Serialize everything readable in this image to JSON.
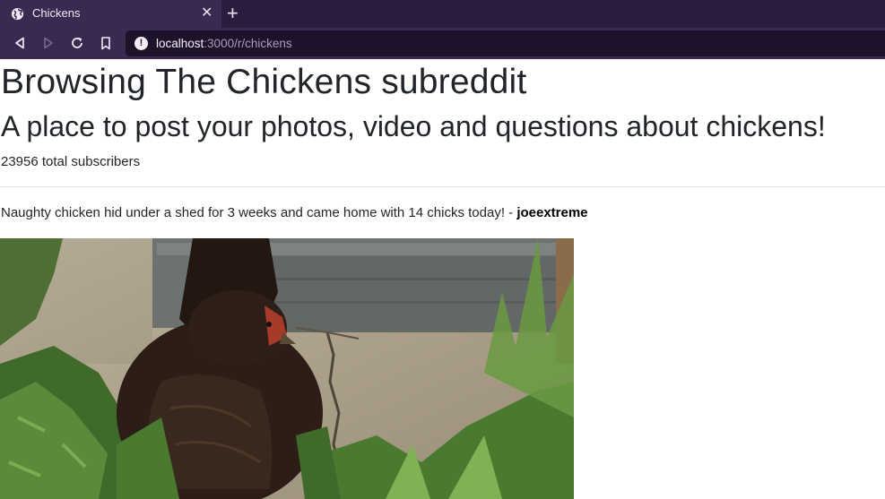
{
  "browser": {
    "tab_title": "Chickens",
    "url_host": "localhost",
    "url_path": ":3000/r/chickens"
  },
  "page": {
    "title": "Browsing The Chickens subreddit",
    "subtitle": "A place to post your photos, video and questions about chickens!",
    "subscribers": "23956 total subscribers"
  },
  "post": {
    "title": "Naughty chicken hid under a shed for 3 weeks and came home with 14 chicks today! - ",
    "author": "joeextreme"
  },
  "icons": {
    "favicon": "globe-icon",
    "close": "close-icon",
    "new_tab": "plus-icon",
    "back": "back-arrow-icon",
    "forward": "forward-arrow-icon",
    "reload": "reload-icon",
    "bookmark": "bookmark-icon",
    "site_info": "info-icon"
  }
}
